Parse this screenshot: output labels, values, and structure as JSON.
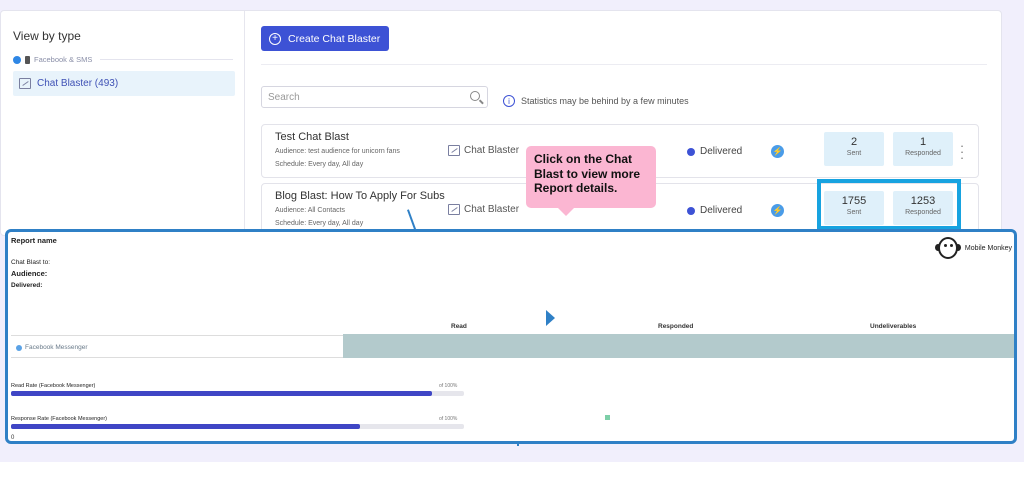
{
  "sidebar": {
    "title": "View by type",
    "section_label": "Facebook & SMS",
    "item_label": "Chat Blaster (493)"
  },
  "toolbar": {
    "create_label": "Create Chat Blaster"
  },
  "search": {
    "placeholder": "Search"
  },
  "notice": "Statistics may be behind by a few minutes",
  "rows": [
    {
      "title": "Test Chat Blast",
      "audience": "Audience: test audience for unicorn fans",
      "schedule": "Schedule: Every day, All day",
      "type": "Chat Blaster",
      "status": "Delivered",
      "sent": "2",
      "sent_label": "Sent",
      "responded": "1",
      "responded_label": "Responded"
    },
    {
      "title": "Blog Blast: How To Apply For Subs",
      "audience": "Audience: All Contacts",
      "schedule": "Schedule: Every day, All day",
      "type": "Chat Blaster",
      "status": "Delivered",
      "sent": "1755",
      "sent_label": "Sent",
      "responded": "1253",
      "responded_label": "Responded"
    }
  ],
  "callout": {
    "text": "Click on the Chat Blast to view more Report details."
  },
  "report": {
    "name_label": "Report name",
    "blast_to_label": "Chat Blast to:",
    "audience_label": "Audience:",
    "delivered_label": "Delivered:",
    "brand": "Mobile Monkey",
    "columns": [
      "Read",
      "Responded",
      "Undeliverables"
    ],
    "platform": "Facebook Messenger",
    "read_rate_label": "Read Rate (Facebook Messenger)",
    "read_rate_of": "of 100%",
    "read_rate_fill": 0.93,
    "response_rate_label": "Response Rate (Facebook Messenger)",
    "response_rate_of": "of 100%",
    "response_rate_fill": 0.77,
    "footer_value": "0"
  },
  "colors": {
    "accent": "#3d52d5",
    "highlight": "#17a3e0",
    "callout": "#fbb6d2",
    "report_border": "#2f80c6",
    "teal_band": "#b3cacc"
  }
}
